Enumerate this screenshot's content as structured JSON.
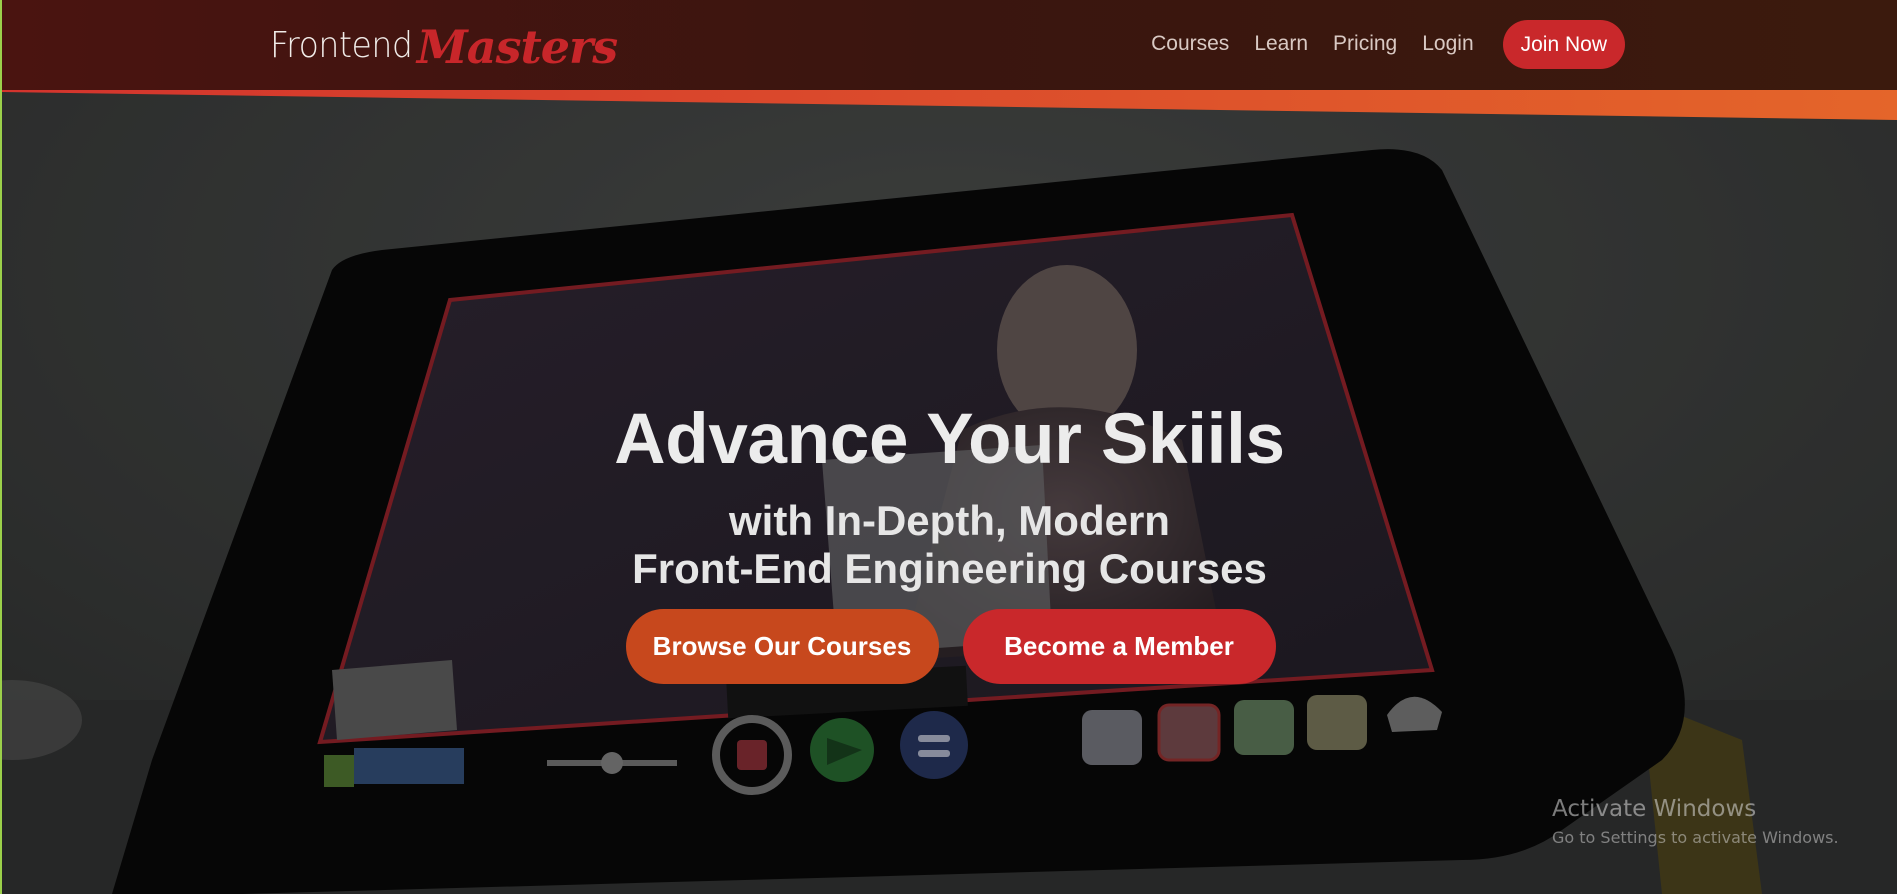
{
  "header": {
    "logo_part1": "Frontend",
    "logo_part2": "Masters",
    "nav": {
      "courses": "Courses",
      "learn": "Learn",
      "pricing": "Pricing",
      "login": "Login"
    },
    "join_label": "Join Now"
  },
  "hero": {
    "title": "Advance Your Skiils",
    "subtitle_line1": "with In-Depth, Modern",
    "subtitle_line2": "Front-End Engineering Courses",
    "browse_label": "Browse Our Courses",
    "member_label": "Become a Member"
  },
  "watermark": {
    "title": "Activate Windows",
    "subtitle": "Go to Settings to activate Windows."
  },
  "colors": {
    "header_bg": "#3a150f",
    "brand_red": "#c9282b",
    "brand_orange": "#c7481d",
    "stripe_orange": "#e4652a"
  }
}
